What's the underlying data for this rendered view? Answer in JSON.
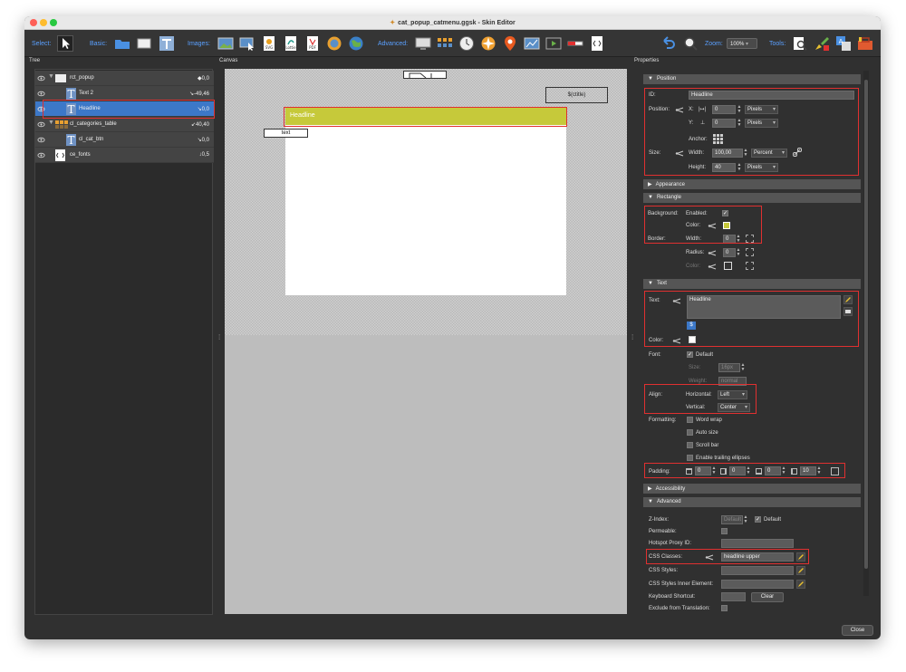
{
  "window": {
    "title": "cat_popup_catmenu.ggsk - Skin Editor",
    "file_icon": "skin-file-icon",
    "traffic_lights": [
      "#fe5f57",
      "#febc2e",
      "#28c840"
    ]
  },
  "toolbar": {
    "select_label": "Select:",
    "basic_label": "Basic:",
    "images_label": "Images:",
    "advanced_label": "Advanced:",
    "zoom_label": "Zoom:",
    "zoom_value": "100%",
    "tools_label": "Tools:",
    "image_button_labels": [
      "SVG",
      "Lottie",
      "PDF"
    ]
  },
  "panels": {
    "tree": "Tree",
    "canvas": "Canvas",
    "properties": "Properties"
  },
  "tree": {
    "items": [
      {
        "name": "rct_popup",
        "value": "◆0,0"
      },
      {
        "name": "Text 2",
        "value": "↘-49,46"
      },
      {
        "name": "Headline",
        "value": "↘0,0"
      },
      {
        "name": "cl_categories_table",
        "value": "↙40,40"
      },
      {
        "name": "cl_cat_btn",
        "value": "↘0,0"
      },
      {
        "name": "ce_fonts",
        "value": "↓0,5"
      }
    ],
    "icon_letters": [
      "T",
      "T",
      "T"
    ]
  },
  "canvas": {
    "ctitle_text": "$(ctitle)",
    "headline_text": "Headline",
    "text_label": "text",
    "headline_color": "#c6c93a"
  },
  "properties": {
    "position": {
      "header": "Position",
      "id_label": "ID:",
      "id_value": "Headline",
      "position_label": "Position:",
      "x_label": "X:",
      "x_value": "0",
      "y_label": "Y:",
      "y_value": "0",
      "x_unit": "Pixels",
      "y_unit": "Pixels",
      "anchor_label": "Anchor:",
      "size_label": "Size:",
      "width_label": "Width:",
      "width_value": "100,00",
      "width_unit": "Percent",
      "height_label": "Height:",
      "height_value": "40",
      "height_unit": "Pixels"
    },
    "appearance": {
      "header": "Appearance"
    },
    "rectangle": {
      "header": "Rectangle",
      "background_label": "Background:",
      "enabled_label": "Enabled:",
      "enabled_check": "✓",
      "color_label": "Color:",
      "bg_color": "#c6c93a",
      "border_label": "Border:",
      "border_width_label": "Width:",
      "border_width_value": "0",
      "radius_label": "Radius:",
      "radius_value": "0",
      "border_color_label": "Color:"
    },
    "text": {
      "header": "Text",
      "text_label": "Text:",
      "text_value": "Headline",
      "color_label": "Color:",
      "text_color": "#ffffff",
      "font_label": "Font:",
      "font_default_label": "Default",
      "font_default_check": "✓",
      "size_label": "Size:",
      "size_value": "16px",
      "weight_label": "Weight:",
      "weight_value": "normal",
      "align_label": "Align:",
      "horizontal_label": "Horizontal:",
      "horizontal_value": "Left",
      "vertical_label": "Vertical:",
      "vertical_value": "Center",
      "formatting_label": "Formatting:",
      "formatting_options": [
        "Word wrap",
        "Auto size",
        "Scroll bar",
        "Enable trailing ellipses"
      ],
      "padding_label": "Padding:",
      "padding_values": [
        "0",
        "0",
        "0",
        "10"
      ]
    },
    "accessibility": {
      "header": "Accessibility"
    },
    "advanced": {
      "header": "Advanced",
      "zindex_label": "Z-Index:",
      "zindex_placeholder": "Default",
      "zindex_default_label": "Default",
      "zindex_default_check": "✓",
      "permeable_label": "Permeable:",
      "hotspot_label": "Hotspot Proxy ID:",
      "css_classes_label": "CSS Classes:",
      "css_classes_value": "headline upper",
      "css_styles_label": "CSS Styles:",
      "css_inner_label": "CSS Styles Inner Element:",
      "keyboard_label": "Keyboard Shortcut:",
      "clear_label": "Clear",
      "exclude_label": "Exclude from Translation:"
    }
  },
  "footer": {
    "close_label": "Close"
  }
}
